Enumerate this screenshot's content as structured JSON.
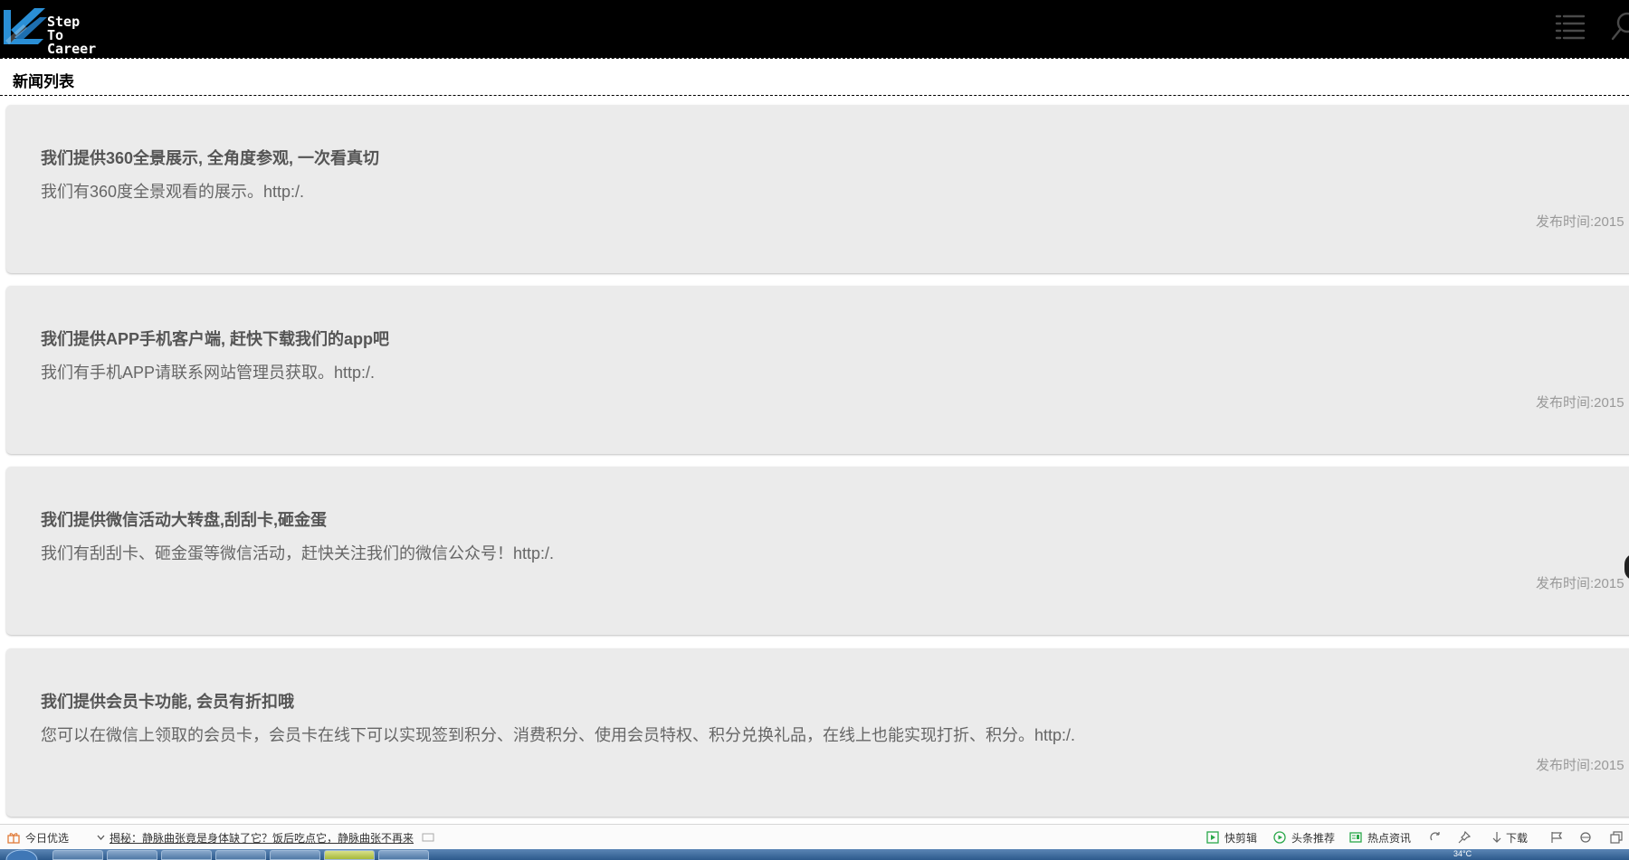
{
  "header": {
    "logo_line1": "Step To",
    "logo_line2": "Career",
    "menu_icon": "list-menu-icon",
    "search_icon": "search-icon"
  },
  "section": {
    "title": "新闻列表"
  },
  "news": [
    {
      "title": "我们提供360全景展示, 全角度参观, 一次看真切",
      "desc": "我们有360度全景观看的展示。http:/.",
      "time": "发布时间:2015"
    },
    {
      "title": "我们提供APP手机客户端, 赶快下载我们的app吧",
      "desc": "我们有手机APP请联系网站管理员获取。http:/.",
      "time": "发布时间:2015"
    },
    {
      "title": "我们提供微信活动大转盘,刮刮卡,砸金蛋",
      "desc": "我们有刮刮卡、砸金蛋等微信活动，赶快关注我们的微信公众号！http:/.",
      "time": "发布时间:2015"
    },
    {
      "title": "我们提供会员卡功能, 会员有折扣哦",
      "desc": "您可以在微信上领取的会员卡，会员卡在线下可以实现签到积分、消费积分、使用会员特权、积分兑换礼品，在线上也能实现打折、积分。http:/.",
      "time": "发布时间:2015"
    }
  ],
  "browser_bar": {
    "daily_pick": "今日优选",
    "news_headline": "揭秘：静脉曲张竟是身体缺了它？饭后吃点它，静脉曲张不再来",
    "clip": "快剪辑",
    "headlines": "头条推荐",
    "hot_news": "热点资讯",
    "download": "下载"
  },
  "taskbar": {
    "tray_temp": "34°C"
  },
  "colors": {
    "header_bg": "#000000",
    "logo_accent": "#2a8fd6",
    "card_bg": "#ebebeb",
    "title_text": "#555555",
    "desc_text": "#666666",
    "time_text": "#999999",
    "toolbar_green": "#2aa84a"
  }
}
